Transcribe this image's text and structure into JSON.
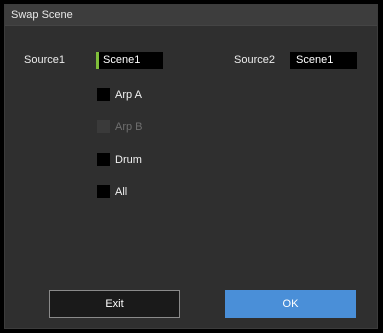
{
  "dialog": {
    "title": "Swap Scene"
  },
  "source1": {
    "label": "Source1",
    "value": "Scene1"
  },
  "source2": {
    "label": "Source2",
    "value": "Scene1"
  },
  "options": [
    {
      "label": "Arp A",
      "checked": false,
      "enabled": true
    },
    {
      "label": "Arp B",
      "checked": false,
      "enabled": false
    },
    {
      "label": "Drum",
      "checked": false,
      "enabled": true
    },
    {
      "label": "All",
      "checked": false,
      "enabled": true
    }
  ],
  "buttons": {
    "exit": "Exit",
    "ok": "OK"
  },
  "colors": {
    "background": "#2f2f2f",
    "titlebar": "#3d3d3d",
    "focus_accent": "#7fbe3a",
    "ok_button": "#4a8fd8"
  }
}
